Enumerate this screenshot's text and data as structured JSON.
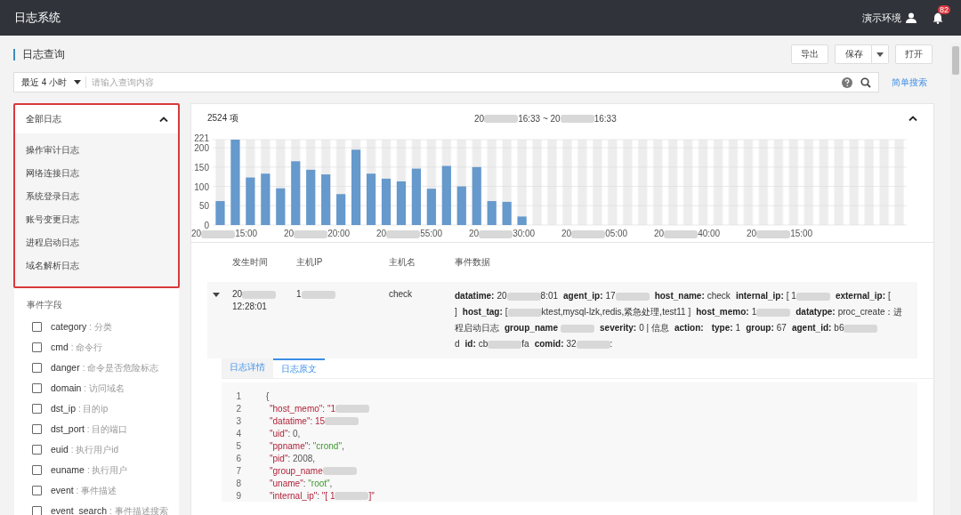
{
  "app": {
    "title": "日志系统",
    "environment": "演示环境",
    "notification_count": "82"
  },
  "page": {
    "title": "日志查询",
    "buttons": [
      {
        "label": "导出",
        "kind": "plain"
      },
      {
        "label": "保存",
        "kind": "split"
      },
      {
        "label": "打开",
        "kind": "plain"
      }
    ]
  },
  "search": {
    "range": "最近 4 小时",
    "placeholder": "请输入查询内容",
    "mode_link": "简单搜索"
  },
  "log_types": {
    "title": "全部日志",
    "expanded": true,
    "items": [
      {
        "label": "操作审计日志",
        "selected": false
      },
      {
        "label": "网络连接日志",
        "selected": false
      },
      {
        "label": "系统登录日志",
        "selected": false
      },
      {
        "label": "账号变更日志",
        "selected": false
      },
      {
        "label": "进程启动日志",
        "selected": false
      },
      {
        "label": "域名解析日志",
        "selected": false
      }
    ]
  },
  "event_fields": {
    "title": "事件字段",
    "items": [
      {
        "name": "category",
        "desc": ": 分类",
        "checked": false
      },
      {
        "name": "cmd",
        "desc": ": 命令行",
        "checked": false
      },
      {
        "name": "danger",
        "desc": ": 命令是否危险标志",
        "checked": false
      },
      {
        "name": "domain",
        "desc": ": 访问域名",
        "checked": false
      },
      {
        "name": "dst_ip",
        "desc": ": 目的ip",
        "checked": false
      },
      {
        "name": "dst_port",
        "desc": ": 目的端口",
        "checked": false
      },
      {
        "name": "euid",
        "desc": ": 执行用户id",
        "checked": false
      },
      {
        "name": "euname",
        "desc": ": 执行用户",
        "checked": false
      },
      {
        "name": "event",
        "desc": ": 事件描述",
        "checked": false
      },
      {
        "name": "event_search",
        "desc": ": 事件描述搜索",
        "checked": false
      }
    ]
  },
  "histogram": {
    "count": "2524 项",
    "range": [
      {
        "kind": "text",
        "text": "20"
      },
      {
        "kind": "blur"
      },
      {
        "kind": "text",
        "text": "16:33 ~ 20"
      },
      {
        "kind": "blur"
      },
      {
        "kind": "text",
        "text": "16:33"
      }
    ],
    "expanded": true,
    "x_labels": [
      [
        {
          "kind": "text",
          "text": "20"
        },
        {
          "kind": "blur"
        },
        {
          "kind": "text",
          "text": "15:00"
        }
      ],
      [
        {
          "kind": "text",
          "text": "20"
        },
        {
          "kind": "blur"
        },
        {
          "kind": "text",
          "text": "20:00"
        }
      ],
      [
        {
          "kind": "text",
          "text": "20"
        },
        {
          "kind": "blur"
        },
        {
          "kind": "text",
          "text": "55:00"
        }
      ],
      [
        {
          "kind": "text",
          "text": "20"
        },
        {
          "kind": "blur"
        },
        {
          "kind": "text",
          "text": "30:00"
        }
      ],
      [
        {
          "kind": "text",
          "text": "20"
        },
        {
          "kind": "blur"
        },
        {
          "kind": "text",
          "text": "05:00"
        }
      ],
      [
        {
          "kind": "text",
          "text": "20"
        },
        {
          "kind": "blur"
        },
        {
          "kind": "text",
          "text": "40:00"
        }
      ],
      [
        {
          "kind": "text",
          "text": "20"
        },
        {
          "kind": "blur"
        },
        {
          "kind": "text",
          "text": "15:00"
        }
      ]
    ],
    "chart_data": {
      "type": "bar",
      "grid": true,
      "ylim": [
        0,
        221
      ],
      "yticks": [
        0,
        50,
        100,
        150,
        200,
        {
          "value": 221,
          "label": "221"
        }
      ],
      "values": [
        62,
        221,
        123,
        133,
        95,
        165,
        143,
        131,
        80,
        195,
        133,
        120,
        113,
        146,
        94,
        153,
        100,
        150,
        62,
        60,
        22,
        0,
        0,
        0,
        0,
        0,
        0,
        0,
        0,
        0,
        0,
        0,
        0,
        0,
        0,
        0,
        0,
        0,
        0,
        0,
        0,
        0,
        0,
        0,
        0,
        0
      ]
    }
  },
  "table": {
    "columns": [
      "发生时间",
      "主机IP",
      "主机名",
      "事件数据"
    ],
    "rows": [
      {
        "expanded": true,
        "time": [
          {
            "kind": "text",
            "text": "20"
          },
          {
            "kind": "blur"
          },
          {
            "kind": "break"
          },
          {
            "kind": "text",
            "text": "12:28:01"
          }
        ],
        "ip": [
          {
            "kind": "text",
            "text": "1"
          },
          {
            "kind": "blur"
          }
        ],
        "host": "check",
        "fields": [
          {
            "key": "datatime:",
            "value": [
              {
                "kind": "text",
                "text": "20"
              },
              {
                "kind": "blur"
              },
              {
                "kind": "text",
                "text": "8:01"
              }
            ]
          },
          {
            "key": "agent_ip:",
            "value": [
              {
                "kind": "text",
                "text": "17"
              },
              {
                "kind": "blur"
              }
            ]
          },
          {
            "key": "host_name:",
            "value": [
              {
                "kind": "text",
                "text": "check"
              }
            ]
          },
          {
            "key": "internal_ip:",
            "value": [
              {
                "kind": "text",
                "text": "[ 1"
              },
              {
                "kind": "blur"
              }
            ]
          },
          {
            "key": "external_ip:",
            "value": [
              {
                "kind": "text",
                "text": "[ ]"
              }
            ]
          },
          {
            "key": "host_tag:",
            "value": [
              {
                "kind": "text",
                "text": "["
              },
              {
                "kind": "blur"
              },
              {
                "kind": "text",
                "text": "ktest,mysql-lzk,redis,紧急处理,test11 ]"
              }
            ]
          },
          {
            "key": "host_memo:",
            "value": [
              {
                "kind": "text",
                "text": "1"
              },
              {
                "kind": "blur"
              }
            ]
          },
          {
            "key": "datatype:",
            "value": [
              {
                "kind": "text",
                "text": "proc_create：进程启动日志"
              }
            ]
          },
          {
            "key": "group_name",
            "value": [
              {
                "kind": "blur"
              }
            ]
          },
          {
            "key": "severity:",
            "value": [
              {
                "kind": "text",
                "text": "0 | 信息"
              }
            ]
          },
          {
            "key": "action:"
          },
          {
            "key": "type:",
            "value": [
              {
                "kind": "text",
                "text": "1"
              }
            ]
          },
          {
            "key": "group:",
            "value": [
              {
                "kind": "text",
                "text": "67"
              }
            ]
          },
          {
            "key": "agent_id:",
            "value": [
              {
                "kind": "text",
                "text": "b6"
              },
              {
                "kind": "blur"
              },
              {
                "kind": "text",
                "text": "d"
              }
            ]
          },
          {
            "key": "id:",
            "value": [
              {
                "kind": "text",
                "text": "cb"
              },
              {
                "kind": "blur"
              },
              {
                "kind": "text",
                "text": "fa"
              }
            ]
          },
          {
            "key": "comid:",
            "value": [
              {
                "kind": "text",
                "text": "32"
              },
              {
                "kind": "blur"
              },
              {
                "kind": "text",
                "text": ":"
              }
            ]
          }
        ]
      }
    ]
  },
  "detail_tabs": [
    {
      "label": "日志详情",
      "selected": false
    },
    {
      "label": "日志原文",
      "selected": true
    }
  ],
  "raw_log": [
    {
      "num": "1",
      "parts": [
        {
          "kind": "punct",
          "text": "{"
        }
      ]
    },
    {
      "num": "2",
      "parts": [
        {
          "kind": "key",
          "text": "\"host_memo\""
        },
        {
          "kind": "punct",
          "text": ": "
        },
        {
          "kind": "key",
          "text": "\"1"
        },
        {
          "kind": "blur"
        }
      ]
    },
    {
      "num": "3",
      "parts": [
        {
          "kind": "key",
          "text": "\"datatime\""
        },
        {
          "kind": "punct",
          "text": ": "
        },
        {
          "kind": "number",
          "text": "15"
        },
        {
          "kind": "blur"
        }
      ]
    },
    {
      "num": "4",
      "parts": [
        {
          "kind": "key",
          "text": "\"uid\""
        },
        {
          "kind": "punct",
          "text": ": 0,"
        }
      ]
    },
    {
      "num": "5",
      "parts": [
        {
          "kind": "key",
          "text": "\"ppname\""
        },
        {
          "kind": "punct",
          "text": ": "
        },
        {
          "kind": "string",
          "text": "\"crond\""
        },
        {
          "kind": "punct",
          "text": ","
        }
      ]
    },
    {
      "num": "6",
      "parts": [
        {
          "kind": "key",
          "text": "\"pid\""
        },
        {
          "kind": "punct",
          "text": ": 2008,"
        }
      ]
    },
    {
      "num": "7",
      "parts": [
        {
          "kind": "key",
          "text": "\"group_name"
        },
        {
          "kind": "blur"
        }
      ]
    },
    {
      "num": "8",
      "parts": [
        {
          "kind": "key",
          "text": "\"uname\""
        },
        {
          "kind": "punct",
          "text": ": "
        },
        {
          "kind": "string",
          "text": "\"root\""
        },
        {
          "kind": "punct",
          "text": ","
        }
      ]
    },
    {
      "num": "9",
      "parts": [
        {
          "kind": "key",
          "text": "\"internal_ip\""
        },
        {
          "kind": "punct",
          "text": ": "
        },
        {
          "kind": "key",
          "text": "\"[ 1"
        },
        {
          "kind": "blur"
        },
        {
          "kind": "key",
          "text": "]\""
        }
      ]
    }
  ]
}
